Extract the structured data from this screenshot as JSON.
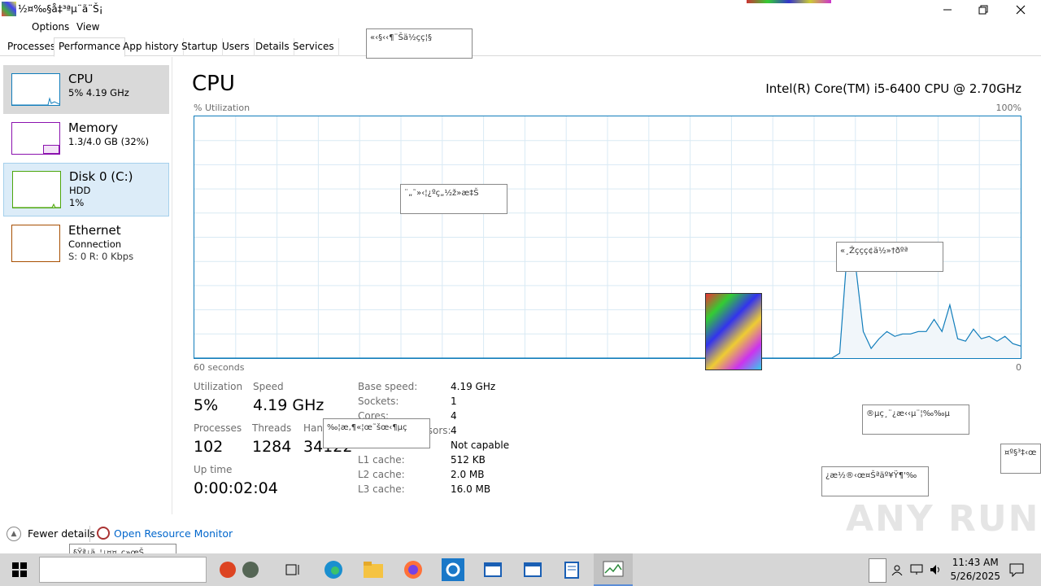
{
  "window": {
    "title": "½¤‰§å‡³ªµ¨ã¨Š¡",
    "minimize_icon": "minimize-icon",
    "maximize_icon": "maximize-icon",
    "close_icon": "close-icon"
  },
  "menu": [
    "Options",
    "View"
  ],
  "tabs": [
    {
      "label": "Processes"
    },
    {
      "label": "Performance"
    },
    {
      "label": "App history"
    },
    {
      "label": "Startup"
    },
    {
      "label": "Users"
    },
    {
      "label": "Details"
    },
    {
      "label": "Services"
    }
  ],
  "sidebar": {
    "items": [
      {
        "title": "CPU",
        "line1": "5%  4.19 GHz",
        "line2": "",
        "color": "#117dbb"
      },
      {
        "title": "Memory",
        "line1": "1.3/4.0 GB (32%)",
        "line2": "",
        "color": "#8b12ae"
      },
      {
        "title": "Disk 0 (C:)",
        "line1": "HDD",
        "line2": "1%",
        "color": "#4da60c"
      },
      {
        "title": "Ethernet",
        "line1": "Connection",
        "line2": "S: 0  R: 0 Kbps",
        "color": "#a74f01"
      }
    ]
  },
  "main": {
    "title": "CPU",
    "cpu_name": "Intel(R) Core(TM) i5-6400 CPU @ 2.70GHz",
    "util_label": "% Utilization",
    "max_label": "100%",
    "time_label": "60 seconds",
    "zero_label": "0"
  },
  "chart_data": {
    "type": "area",
    "ylim": [
      0,
      100
    ],
    "color": "#117dbb",
    "values": [
      0,
      0,
      0,
      0,
      0,
      0,
      0,
      0,
      0,
      0,
      0,
      0,
      0,
      0,
      0,
      0,
      0,
      0,
      0,
      0,
      0,
      0,
      0,
      0,
      0,
      0,
      0,
      0,
      0,
      0,
      0,
      0,
      0,
      0,
      0,
      0,
      0,
      0,
      0,
      0,
      0,
      0,
      0,
      0,
      0,
      0,
      0,
      0,
      0,
      0,
      0,
      0,
      0,
      0,
      0,
      0,
      0,
      0,
      0,
      0,
      0,
      0,
      0,
      0,
      0,
      0,
      0,
      0,
      0,
      0,
      0,
      0,
      0,
      0,
      0,
      0,
      0,
      0,
      0,
      0,
      0,
      0,
      2,
      46,
      39,
      11,
      4,
      8,
      11,
      9,
      10,
      10,
      11,
      11,
      16,
      11,
      22,
      8,
      7,
      12,
      8,
      9,
      7,
      9,
      6,
      5
    ]
  },
  "stats": {
    "utilization_label": "Utilization",
    "utilization": "5%",
    "speed_label": "Speed",
    "speed": "4.19 GHz",
    "processes_label": "Processes",
    "processes": "102",
    "threads_label": "Threads",
    "threads": "1284",
    "handles_label": "Hand",
    "handles": "34122",
    "uptime_label": "Up time",
    "uptime": "0:00:02:04"
  },
  "details": [
    {
      "key": "Base speed:",
      "value": "4.19 GHz"
    },
    {
      "key": "Sockets:",
      "value": "1"
    },
    {
      "key": "Cores:",
      "value": "4"
    },
    {
      "key": "Logical processors:",
      "value": "4"
    },
    {
      "key": "Virtualization:",
      "value": "Not capable"
    },
    {
      "key": "L1 cache:",
      "value": "512 KB"
    },
    {
      "key": "L2 cache:",
      "value": "2.0 MB"
    },
    {
      "key": "L3 cache:",
      "value": "16.0 MB"
    }
  ],
  "bottom": {
    "fewer_details": "Fewer details",
    "resource_monitor": "Open Resource Monitor"
  },
  "popups": [
    "«‹§‹‹¶¨Šä½çç¦§",
    "¨„˜»‹¦¿ºç„½ž»æ‡Š",
    "«¸Žççç¢ä½»†ðºª",
    "‰¦æ‚¶«¦œ˜šœ‹¶µç",
    "®µç¸¨¿æ‹‹µ¨¦‰‰µ",
    "¿æ½®‹œ¤Šªäº¥Ÿ¶'‰",
    "¤º§³‡‹œ",
    "§Ÿª¿ä„¦¿¤¤¸ç»œŠ"
  ],
  "taskbar": {
    "start_icon": "windows-start-icon",
    "taskview_icon": "task-view-icon",
    "time": "11:43 AM",
    "date": "5/26/2025"
  },
  "watermark": "ANY RUN"
}
